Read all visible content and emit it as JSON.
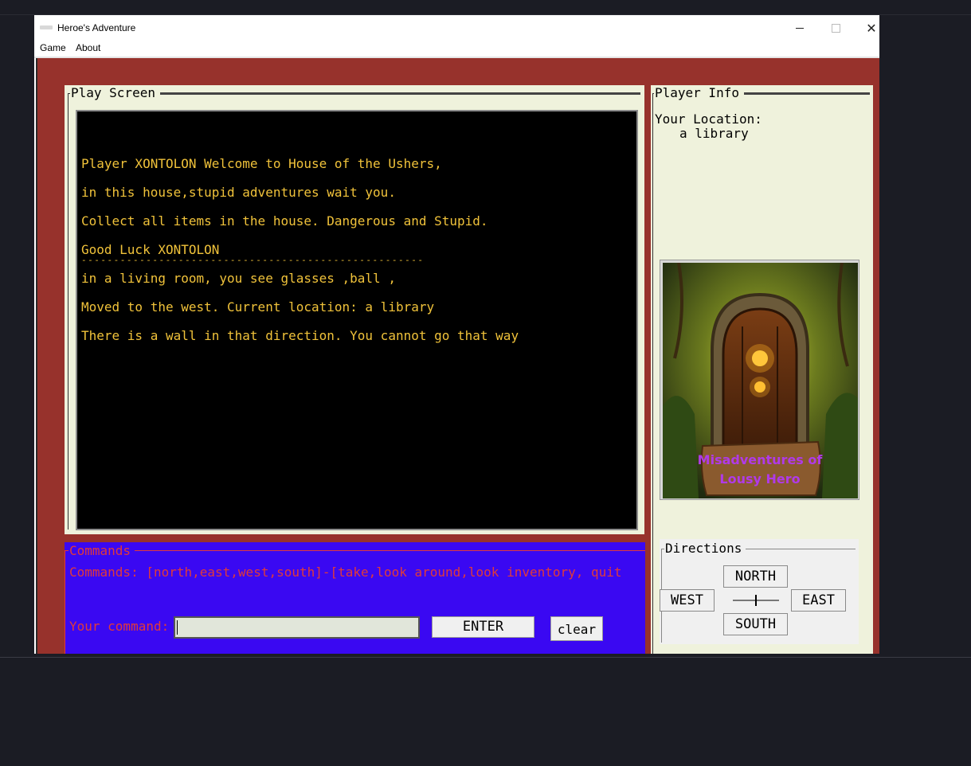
{
  "window": {
    "title": "Heroe's Adventure",
    "close_symbol": "✕"
  },
  "menu": {
    "items": [
      "Game",
      "About"
    ]
  },
  "play_screen": {
    "label": "Play Screen",
    "lines": [
      "Player XONTOLON Welcome to House of the Ushers,",
      "in this house,stupid adventures wait you.",
      "Collect all items in the house. Dangerous and Stupid.",
      "Good Luck XONTOLON",
      "-----------------------------------------------------",
      "in a living room, you see glasses ,ball ,",
      "Moved to the west. Current location: a library",
      "There is a wall in that direction. You cannot go that way"
    ]
  },
  "commands": {
    "label": "Commands",
    "help_text": "Commands: [north,east,west,south]-[take,look around,look inventory, quit",
    "input_label": "Your command:",
    "input_value": "",
    "enter_label": "ENTER",
    "clear_label": "clear"
  },
  "player_info": {
    "label": "Player Info",
    "location_label": "Your Location:",
    "location_value": "a library",
    "poster_title_line1": "Misadventures of",
    "poster_title_line2": "Lousy Hero"
  },
  "directions": {
    "label": "Directions",
    "north": "NORTH",
    "south": "SOUTH",
    "west": "WEST",
    "east": "EAST"
  },
  "colors": {
    "background_red": "#97322c",
    "panel_cream": "#eff2dc",
    "terminal_text": "#f0c23a",
    "commands_bg": "#3a08f2",
    "commands_text": "#e03a3a"
  }
}
